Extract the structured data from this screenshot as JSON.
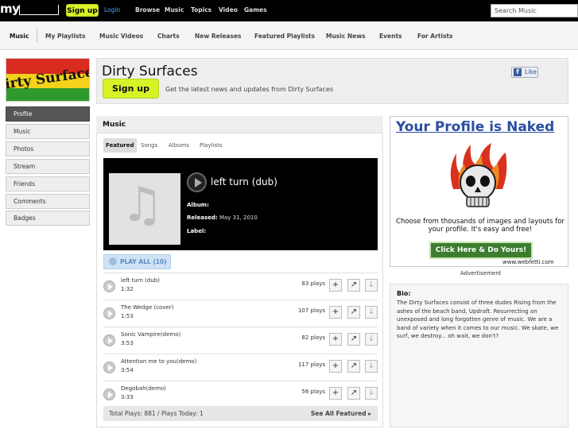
{
  "topbar": {
    "logo": "my",
    "signup_label": "Sign up",
    "login_label": "Login",
    "nav": [
      "Browse",
      "Music",
      "Topics",
      "Video",
      "Games"
    ],
    "search_placeholder": "Search Music"
  },
  "subnav": {
    "items": [
      "Music",
      "My Playlists",
      "Music Videos",
      "Charts",
      "New Releases",
      "Featured Playlists",
      "Music News",
      "Events",
      "For Artists"
    ]
  },
  "sidebar": {
    "band_logo": "Dirty Surfaces",
    "items": [
      "Profile",
      "Music",
      "Photos",
      "Stream",
      "Friends",
      "Comments",
      "Badges"
    ],
    "active": "Profile"
  },
  "header": {
    "band_name": "Dirty Surfaces",
    "signup_label": "Sign up",
    "tagline": "Get the latest news and updates from Dirty Surfaces",
    "like_label": "Like"
  },
  "music": {
    "title": "Music",
    "tabs": [
      "Featured",
      "Songs",
      "Albums",
      "Playlists"
    ],
    "active_tab": "Featured",
    "featured": {
      "label": "",
      "title": "left turn (dub)",
      "album_label": "Album:",
      "album": "",
      "released_label": "Released:",
      "released": "May 31, 2010",
      "label_label": "Label:"
    },
    "play_all": "PLAY ALL (10)",
    "songs": [
      {
        "name": "left turn (dub)",
        "duration": "1:32",
        "plays": "83 plays"
      },
      {
        "name": "The Wedge (cover)",
        "duration": "1:53",
        "plays": "107 plays"
      },
      {
        "name": "Sonic Vampire(demo)",
        "duration": "3:53",
        "plays": "82 plays"
      },
      {
        "name": "Attention me to you(demo)",
        "duration": "3:54",
        "plays": "117 plays"
      },
      {
        "name": "Degobah(demo)",
        "duration": "3:33",
        "plays": "56 plays"
      }
    ],
    "totals": "Total Plays: 881 / Plays Today: 1",
    "see_all": "See All Featured ▸"
  },
  "ad": {
    "headline": "Your Profile is Naked",
    "text": "Choose from thousands of images and layouts for your profile. It's easy and free!",
    "button": "Click Here & Do Yours!",
    "url": "www.webfetti.com",
    "label": "Advertisement"
  },
  "bio": {
    "title": "Bio:",
    "text": "The Dirty Surfaces consist of three dudes Rising from the ashes of the beach band, Updraft. Resurrecting an unexposed and long forgotten genre of music. We are a band of variety when it comes to our music. We skate, we surf, we destroy... oh wait, we don't?"
  },
  "colors": {
    "accent_green": "#d7f226",
    "link_blue": "#4da9ff",
    "featured_orange": "#e38c3c",
    "ad_blue": "#2a4ea0"
  }
}
